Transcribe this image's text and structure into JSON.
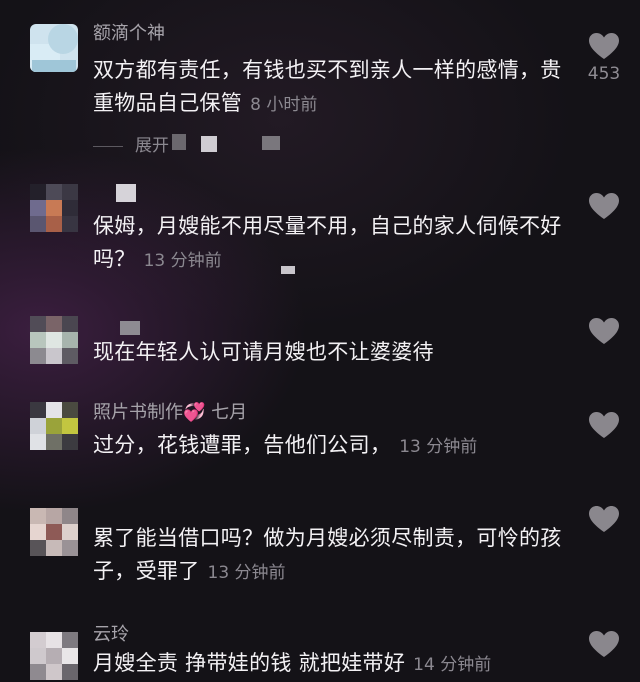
{
  "comments": [
    {
      "username": "额滴个神",
      "text": "双方都有责任，有钱也买不到亲人一样的感情，贵重物品自己保管",
      "time": "8 小时前",
      "likes": "453"
    },
    {
      "username": "",
      "text": "保姆，月嫂能不用尽量不用，自己的家人伺候不好吗？",
      "time": "13 分钟前",
      "likes": ""
    },
    {
      "username": "",
      "text": "现在年轻人认可请月嫂也不让婆婆待",
      "time": "",
      "likes": ""
    },
    {
      "username": "照片书制作💞 七月",
      "text": "过分，花钱遭罪，告他们公司，",
      "time": "13 分钟前",
      "likes": ""
    },
    {
      "username": "",
      "text": "累了能当借口吗？做为月嫂必须尽制责，可怜的孩子，受罪了",
      "time": "13 分钟前",
      "likes": ""
    },
    {
      "username": "云玲",
      "text": "月嫂全责 挣带娃的钱 就把娃带好",
      "time": "14 分钟前",
      "likes": ""
    }
  ],
  "expand_label": "展开",
  "icons": {
    "like": "heart-icon"
  },
  "colors": {
    "background": "#141217",
    "text": "#f3f1f4",
    "meta": "#8b8890"
  }
}
